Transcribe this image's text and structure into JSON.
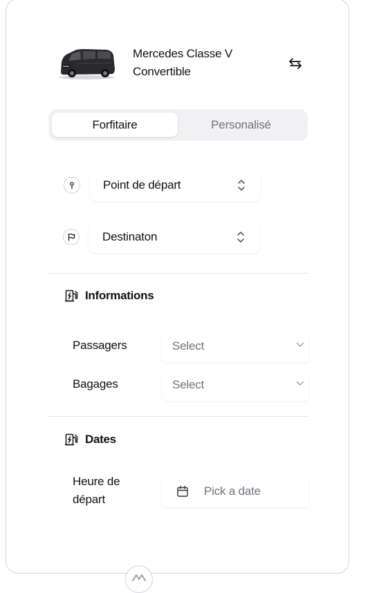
{
  "vehicle": {
    "name": "Mercedes Classe V",
    "type": "Convertible",
    "image_icon": "van-image",
    "swap_icon": "swap-arrows-icon"
  },
  "tabs": [
    {
      "label": "Forfitaire",
      "active": true
    },
    {
      "label": "Personalisé",
      "active": false
    }
  ],
  "route": {
    "departure": {
      "label": "Point de départ",
      "icon": "map-pin-icon"
    },
    "destination": {
      "label": "Destinaton",
      "icon": "flag-icon"
    }
  },
  "informations": {
    "title": "Informations",
    "icon": "fuel-pump-icon",
    "fields": [
      {
        "label": "Passagers",
        "placeholder": "Select"
      },
      {
        "label": "Bagages",
        "placeholder": "Select"
      }
    ]
  },
  "dates": {
    "title": "Dates",
    "icon": "fuel-pump-icon",
    "departure_label": "Heure de départ",
    "date_placeholder": "Pick a date"
  },
  "colors": {
    "muted_text": "#71717a",
    "border": "#d4d4d8",
    "tab_bg": "#f1f1f3"
  }
}
